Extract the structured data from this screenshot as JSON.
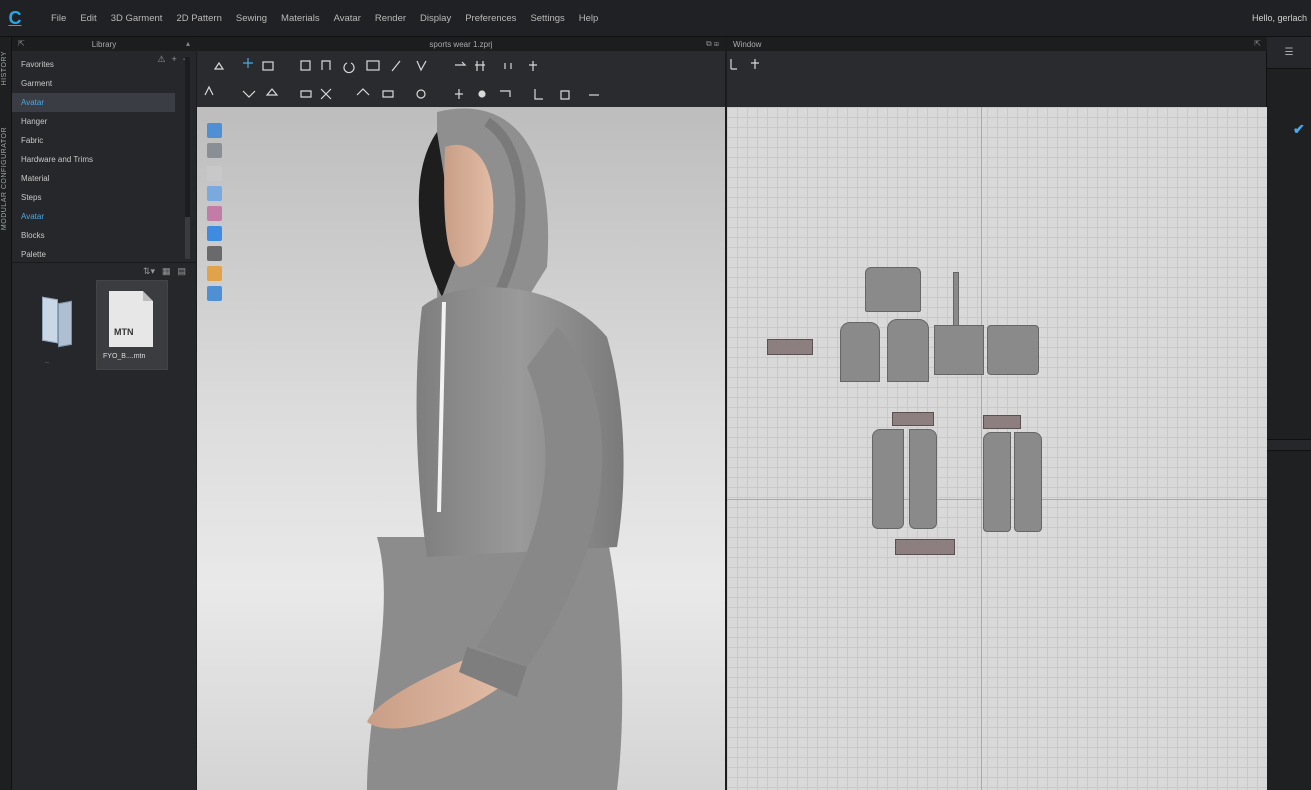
{
  "menubar": {
    "logo": "C",
    "items": [
      "File",
      "Edit",
      "3D Garment",
      "2D Pattern",
      "Sewing",
      "Materials",
      "Avatar",
      "Render",
      "Display",
      "Preferences",
      "Settings",
      "Help"
    ],
    "user_greeting": "Hello, gerlach"
  },
  "side_strip": {
    "labels": [
      "HISTORY",
      "MODULAR CONFIGURATOR"
    ]
  },
  "library": {
    "title": "Library",
    "items": [
      "Favorites",
      "Garment",
      "Avatar",
      "Hanger",
      "Fabric",
      "Hardware and Trims",
      "Material",
      "Steps",
      "Avatar",
      "Blocks",
      "Palette"
    ],
    "selected_index": 2,
    "files": [
      {
        "label": "..",
        "type": "folder"
      },
      {
        "label": "FYO_B....mtn",
        "tag": "MTN",
        "type": "file"
      }
    ]
  },
  "window3d": {
    "title": "sports wear 1.zprj"
  },
  "window2d": {
    "title": "Window"
  },
  "icons": {
    "ctrl": "⧉ ⊞"
  },
  "colors": {
    "accent": "#4ea7e2",
    "menubar": "#202124",
    "panel": "#26272a",
    "canvas": "#d9d9d9",
    "garment": "#8a8a8a"
  }
}
